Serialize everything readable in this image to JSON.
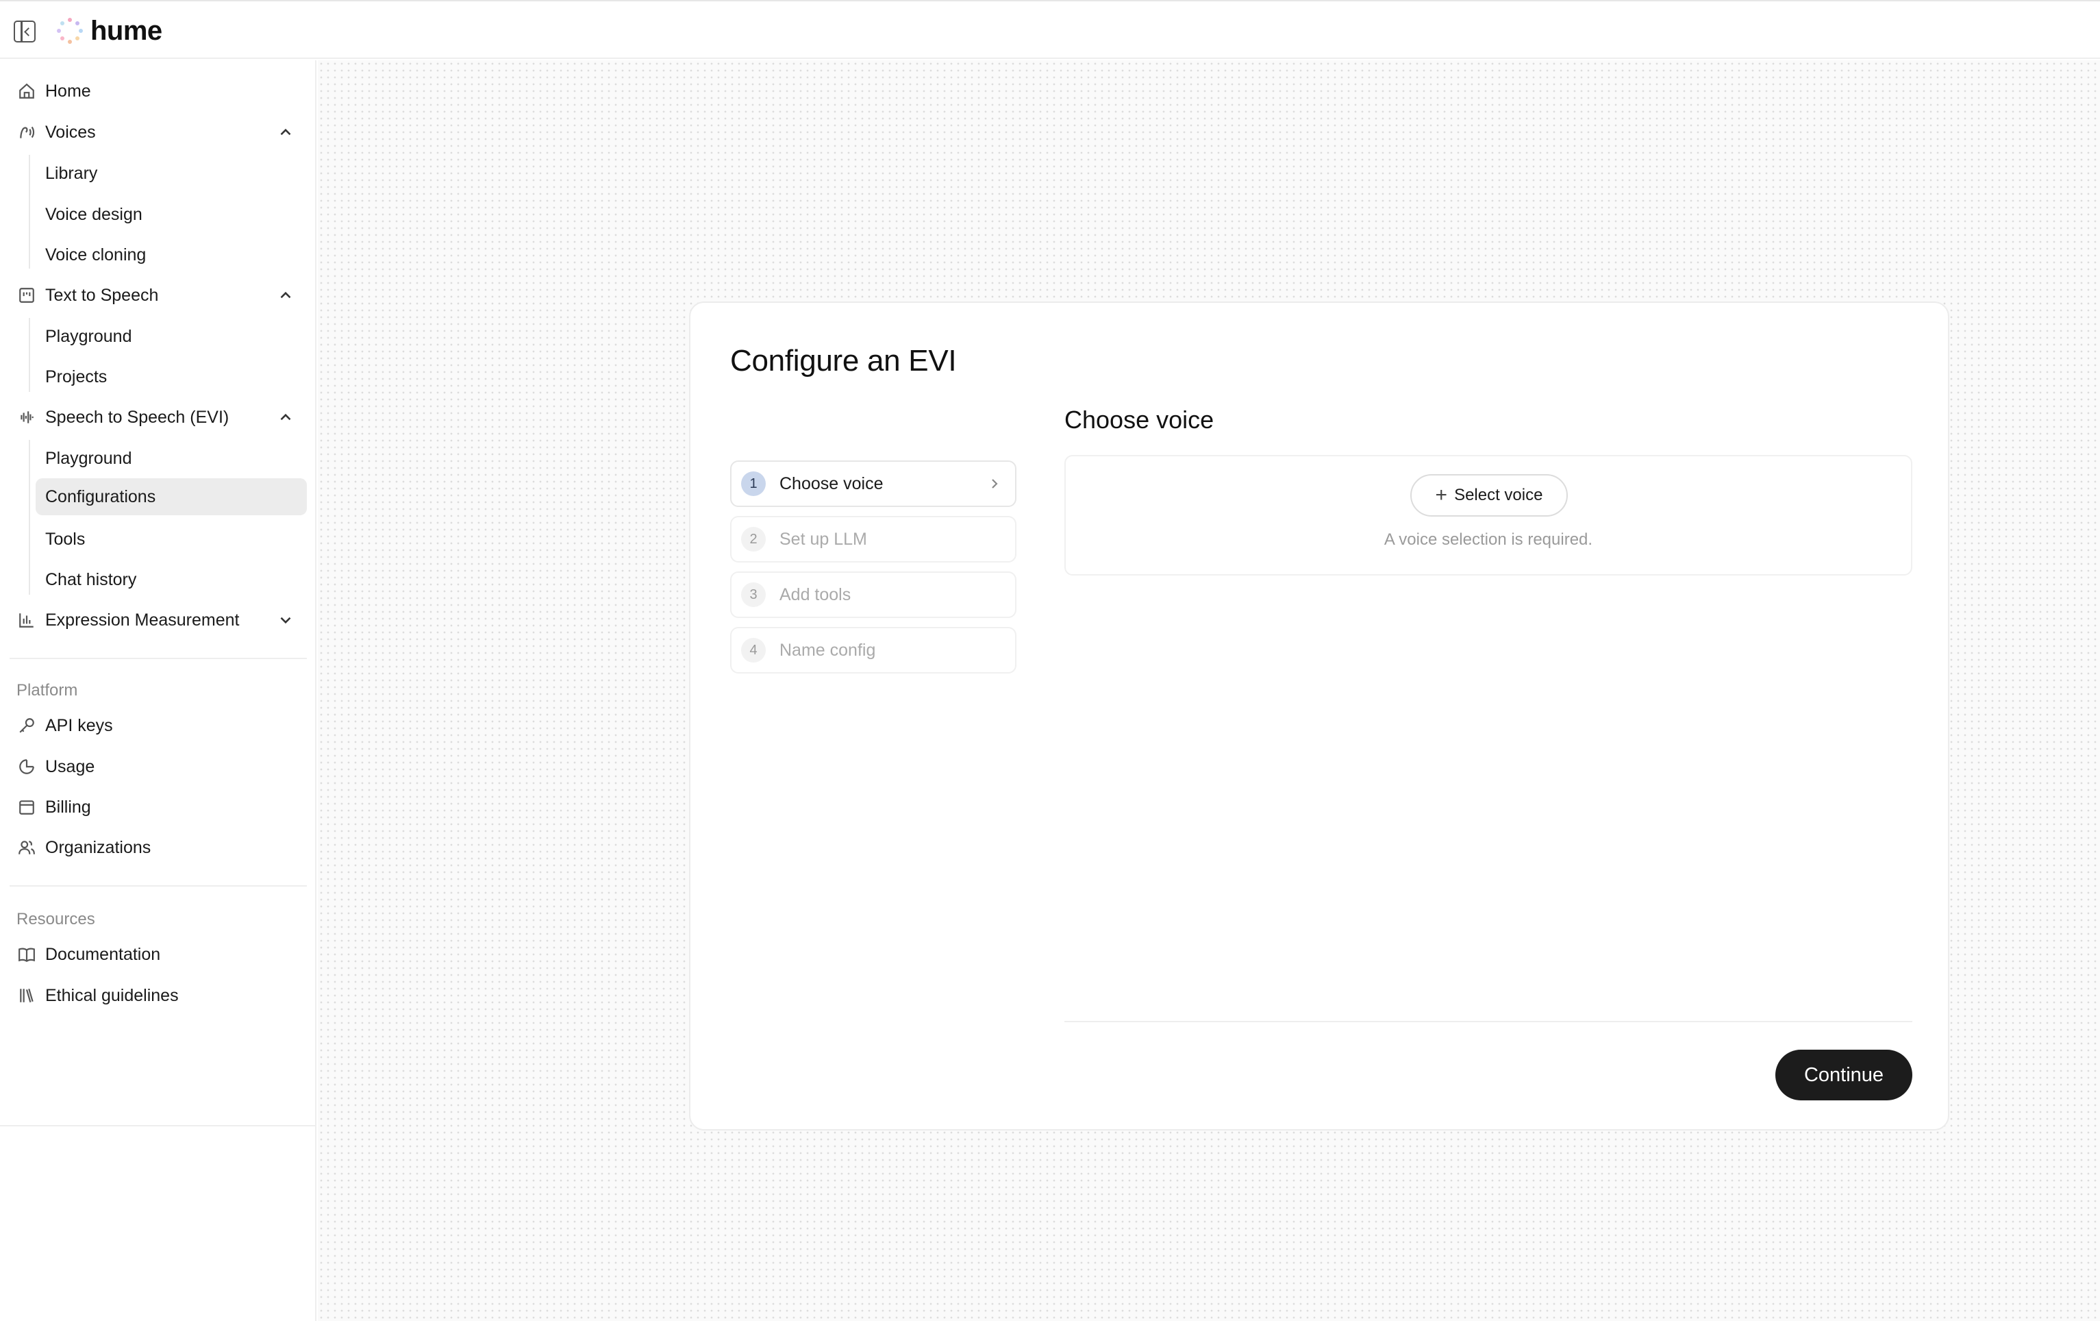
{
  "brand": {
    "name": "hume"
  },
  "sidebar": {
    "home": "Home",
    "voices": {
      "label": "Voices",
      "items": [
        "Library",
        "Voice design",
        "Voice cloning"
      ]
    },
    "tts": {
      "label": "Text to Speech",
      "items": [
        "Playground",
        "Projects"
      ]
    },
    "evi": {
      "label": "Speech to Speech (EVI)",
      "items": [
        "Playground",
        "Configurations",
        "Tools",
        "Chat history"
      ],
      "active": "Configurations"
    },
    "expression": {
      "label": "Expression Measurement"
    },
    "platform": {
      "label": "Platform",
      "items": [
        "API keys",
        "Usage",
        "Billing",
        "Organizations"
      ]
    },
    "resources": {
      "label": "Resources",
      "items": [
        "Documentation",
        "Ethical guidelines"
      ]
    }
  },
  "card": {
    "title": "Configure an EVI",
    "steps": [
      {
        "num": "1",
        "label": "Choose voice"
      },
      {
        "num": "2",
        "label": "Set up LLM"
      },
      {
        "num": "3",
        "label": "Add tools"
      },
      {
        "num": "4",
        "label": "Name config"
      }
    ],
    "section_title": "Choose voice",
    "select_voice_label": "Select voice",
    "hint": "A voice selection is required.",
    "continue_label": "Continue"
  },
  "colors": {
    "accent_step": "#c9d6ec",
    "primary_button": "#1c1c1c",
    "active_nav": "#ececec"
  }
}
